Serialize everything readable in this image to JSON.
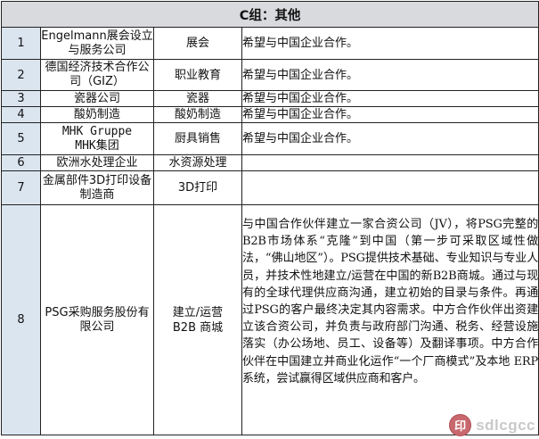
{
  "table": {
    "title": "C组：其他",
    "rows": [
      {
        "num": "1",
        "name": "Engelmann展会设立与服务公司",
        "category": "展会",
        "desc": "希望与中国企业合作。"
      },
      {
        "num": "2",
        "name": "德国经济技术合作公司（GIZ）",
        "category": "职业教育",
        "desc": "希望与中国企业合作。"
      },
      {
        "num": "3",
        "name": "瓷器公司",
        "category": "瓷器",
        "desc": "希望与中国企业合作。"
      },
      {
        "num": "4",
        "name": "酸奶制造",
        "category": "酸奶制造",
        "desc": "希望与中国企业合作。"
      },
      {
        "num": "5",
        "name_line1": "MHK Gruppe",
        "name_line2": "MHK集团",
        "category": "厨具销售",
        "desc": "希望与中国企业合作。"
      },
      {
        "num": "6",
        "name": "欧洲水处理企业",
        "category": "水资源处理",
        "desc": ""
      },
      {
        "num": "7",
        "name": "金属部件3D打印设备制造商",
        "category": "3D打印",
        "desc": ""
      },
      {
        "num": "8",
        "name": "PSG采购服务股份有限公司",
        "category_line1": "建立/运营",
        "category_line2": "B2B 商城",
        "desc": "与中国合作伙伴建立一家合资公司（JV），将PSG完整的B2B市场体系“克隆”到中国（第一步可采取区域性做法，“佛山地区”）。PSG提供技术基础、专业知识与专业人员，并技术性地建立/运营在中国的新B2B商城。通过与现有的全球代理供应商沟通，建立初始的目录与条件。再通过PSG的客户最终决定其内容需求。中方合作伙伴出资建立该合资公司，并负责与政府部门沟通、税务、经营设施落实（办公场地、员工、设备等）及翻译事项。中方合作伙伴在中国建立并商业化运作“一个厂商模式”及本地 ERP 系统，尝试赢得区域供应商和客户。"
      }
    ]
  },
  "watermark": {
    "badge": "印",
    "text": "sdlcgcc"
  }
}
